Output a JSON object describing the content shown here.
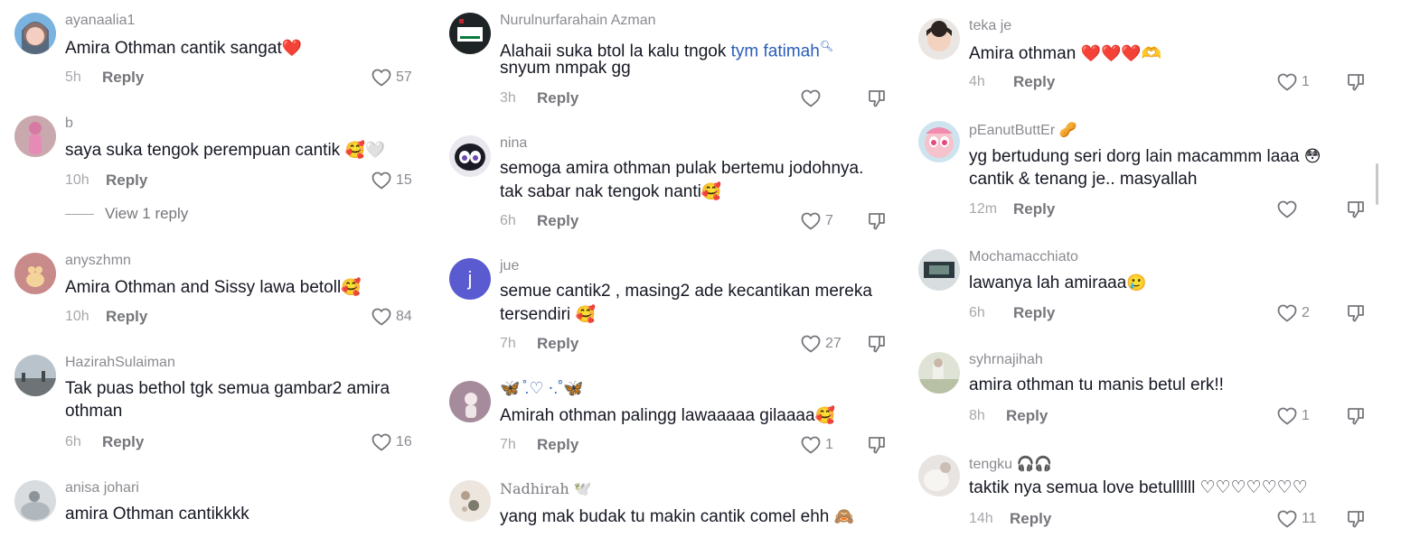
{
  "columns": [
    {
      "comments": [
        {
          "username": "ayanaalia1",
          "text": "Amira Othman cantik sangat",
          "emoji": "❤️",
          "time": "5h",
          "reply": "Reply",
          "likes": "57"
        },
        {
          "username": "b",
          "text": "saya suka tengok perempuan cantik",
          "emoji": "🥰🤍",
          "time": "10h",
          "reply": "Reply",
          "likes": "15",
          "view_replies": "View 1 reply"
        },
        {
          "username": "anyszhmn",
          "text": "Amira Othman and Sissy lawa betoll",
          "emoji": "🥰",
          "time": "10h",
          "reply": "Reply",
          "likes": "84"
        },
        {
          "username": "HazirahSulaiman",
          "text": "Tak puas bethol tgk semua gambar2 amira",
          "text2": "othman",
          "time": "6h",
          "reply": "Reply",
          "likes": "16"
        },
        {
          "username": "anisa johari",
          "text": "amira Othman cantikkkk"
        }
      ]
    },
    {
      "comments": [
        {
          "username": "Nurulnurfarahain Azman",
          "text": "Alahaii suka btol la kalu tngok",
          "mention": "tym fatimah",
          "text2": "snyum nmpak gg",
          "time": "3h",
          "reply": "Reply",
          "likes": ""
        },
        {
          "username": "nina",
          "text": "semoga amira othman pulak bertemu jodohnya.",
          "text2": "tak sabar nak tengok nanti",
          "emoji": "🥰",
          "time": "6h",
          "reply": "Reply",
          "likes": "7"
        },
        {
          "username": "jue",
          "avatar_letter": "j",
          "text": "semue cantik2 , masing2 ade kecantikan mereka",
          "text2": "tersendiri",
          "emoji": "🥰",
          "time": "7h",
          "reply": "Reply",
          "likes": "27"
        },
        {
          "username": "🦋 ̊.♡ ⋅.˚🦋",
          "text": "Amirah othman palingg lawaaaaa gilaaaa",
          "emoji": "🥰",
          "time": "7h",
          "reply": "Reply",
          "likes": "1"
        },
        {
          "username": "Nadhirah 🕊️",
          "text": "yang mak budak tu makin cantik comel ehh",
          "emoji": "🙈"
        }
      ]
    },
    {
      "comments": [
        {
          "username": "teka je",
          "text": "Amira othman",
          "emoji": "❤️❤️❤️🫶",
          "time": "4h",
          "reply": "Reply",
          "likes": "1"
        },
        {
          "username": "pEanutButtEr 🥜",
          "text": "yg bertudung seri dorg lain macammm laaa",
          "emoji": "😳",
          "text2": "cantik & tenang je.. masyallah",
          "time": "12m",
          "reply": "Reply",
          "likes": ""
        },
        {
          "username": "Mochamacchiato",
          "text": "lawanya lah amiraaa",
          "emoji": "🥲",
          "time": "6h",
          "reply": "Reply",
          "likes": "2"
        },
        {
          "username": "syhrnajihah",
          "text": "amira othman tu manis betul erk!!",
          "time": "8h",
          "reply": "Reply",
          "likes": "1"
        },
        {
          "username": "tengku 🎧🎧",
          "text": "taktik nya semua love betullllll ♡♡♡♡♡♡♡",
          "time": "14h",
          "reply": "Reply",
          "likes": "11"
        }
      ]
    }
  ],
  "icons": {
    "like": "heart-outline-icon",
    "dislike": "thumbs-down-icon"
  },
  "colors": {
    "text": "#161823",
    "meta": "#a7a8ac",
    "mention": "#2b5db9"
  }
}
